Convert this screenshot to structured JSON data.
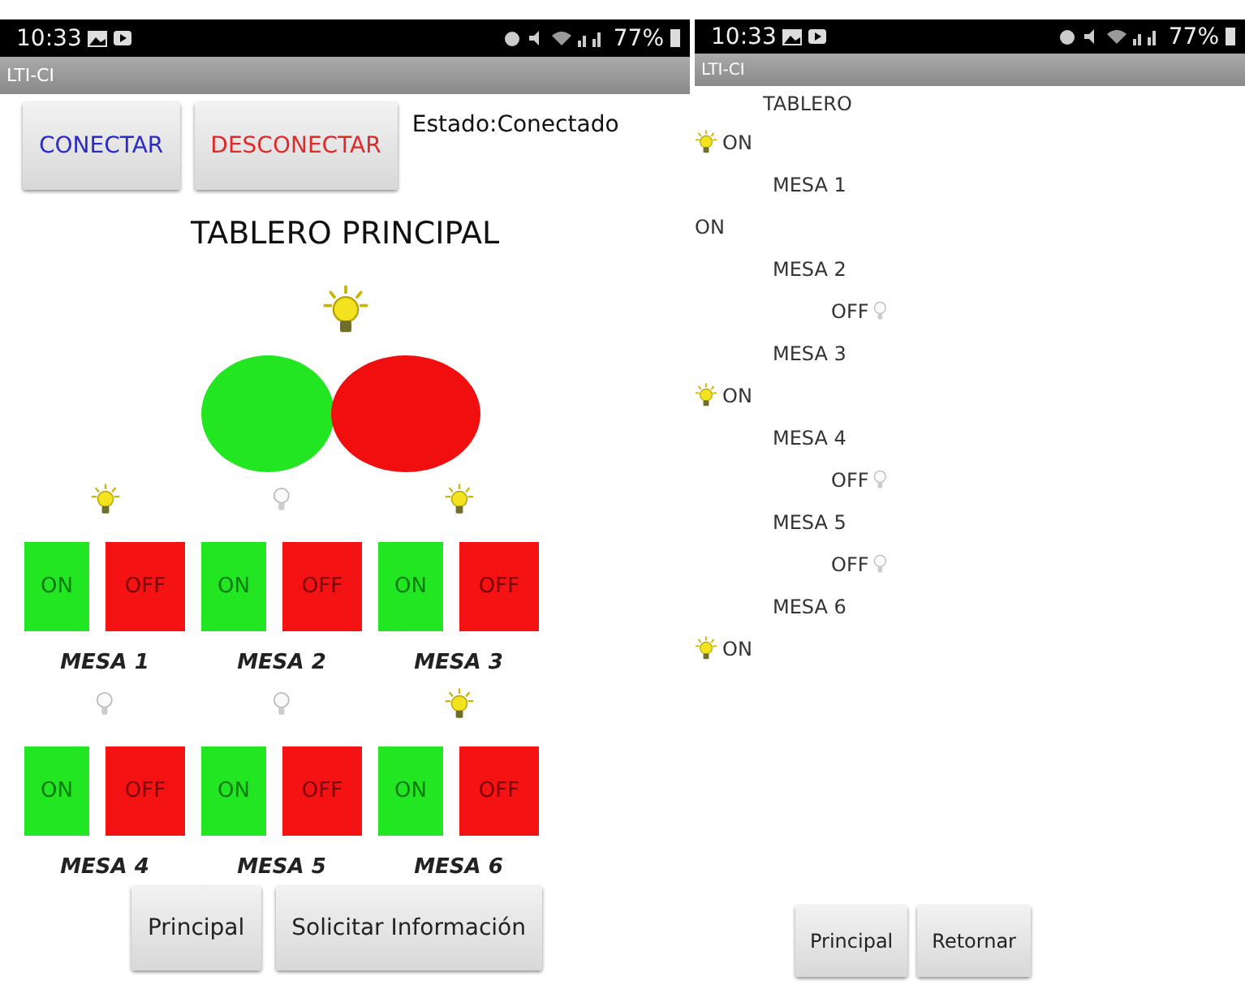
{
  "control_screen": {
    "status_bar": {
      "time": "10:33",
      "battery": "77%"
    },
    "app_title": "LTI-CI",
    "connection_buttons": [
      {
        "label": "CONECTAR",
        "kind": "connect"
      },
      {
        "label": "DESCONECTAR",
        "kind": "disconnect"
      }
    ],
    "status_text": "Estado:Conectado",
    "heading": "TABLERO PRINCIPAL",
    "main_on": true,
    "mesas": [
      {
        "name": "MESA 1",
        "on": true,
        "on_label": "ON",
        "off_label": "OFF"
      },
      {
        "name": "MESA 2",
        "on": false,
        "on_label": "ON",
        "off_label": "OFF"
      },
      {
        "name": "MESA 3",
        "on": true,
        "on_label": "ON",
        "off_label": "OFF"
      },
      {
        "name": "MESA 4",
        "on": false,
        "on_label": "ON",
        "off_label": "OFF"
      },
      {
        "name": "MESA 5",
        "on": false,
        "on_label": "ON",
        "off_label": "OFF"
      },
      {
        "name": "MESA 6",
        "on": true,
        "on_label": "ON",
        "off_label": "OFF"
      }
    ],
    "bottom_buttons": [
      "Principal",
      "Solicitar Información"
    ]
  },
  "info_screen": {
    "status_bar": {
      "time": "10:33",
      "battery": "77%"
    },
    "app_title": "LTI-CI",
    "items": [
      {
        "name": "TABLERO",
        "state": "ON",
        "on": true,
        "icon": true
      },
      {
        "name": "MESA 1",
        "state": "ON",
        "on": true,
        "icon": false
      },
      {
        "name": "MESA 2",
        "state": "OFF",
        "on": false,
        "icon": true
      },
      {
        "name": "MESA 3",
        "state": "ON",
        "on": true,
        "icon": true
      },
      {
        "name": "MESA 4",
        "state": "OFF",
        "on": false,
        "icon": true
      },
      {
        "name": "MESA 5",
        "state": "OFF",
        "on": false,
        "icon": true
      },
      {
        "name": "MESA 6",
        "state": "ON",
        "on": true,
        "icon": true
      }
    ],
    "bottom_buttons": [
      "Principal",
      "Retornar"
    ]
  }
}
